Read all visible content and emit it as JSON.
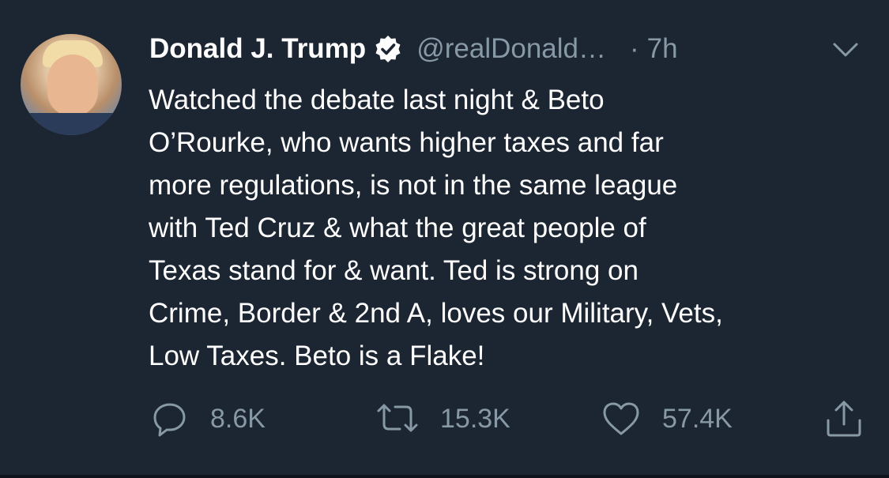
{
  "tweet": {
    "author_name": "Donald J. Trump",
    "handle": "@realDonald…",
    "separator": "·",
    "time": "7h",
    "text_lines": [
      "Watched the debate last night & Beto",
      "O’Rourke, who wants higher taxes and far",
      "more regulations, is not in the same league",
      "with Ted Cruz & what the great people of",
      "Texas stand for & want. Ted is strong on",
      "Crime, Border & 2nd A, loves our Military, Vets,",
      "Low Taxes. Beto is a Flake!"
    ]
  },
  "actions": {
    "reply_count": "8.6K",
    "retweet_count": "15.3K",
    "like_count": "57.4K"
  },
  "icons": {
    "verified": "verified-badge-icon",
    "more": "chevron-down-icon",
    "reply": "reply-icon",
    "retweet": "retweet-icon",
    "like": "heart-icon",
    "share": "share-icon"
  },
  "colors": {
    "background": "#1c2532",
    "primary_text": "#ffffff",
    "secondary_text": "#8899a6"
  }
}
